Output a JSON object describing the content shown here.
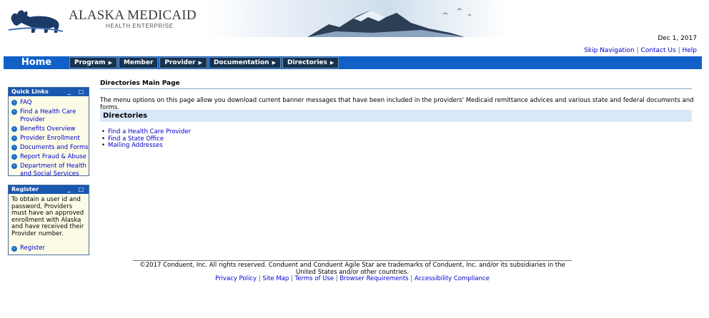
{
  "header": {
    "brand_title": "ALASKA MEDICAID",
    "brand_subtitle": "HEALTH ENTERPRISE",
    "date": "Dec 1, 2017",
    "top_links": [
      "Skip Navigation",
      "Contact Us",
      "Help"
    ]
  },
  "nav": {
    "home": "Home",
    "items": [
      {
        "label": "Program",
        "arrow": true
      },
      {
        "label": "Member",
        "arrow": false
      },
      {
        "label": "Provider",
        "arrow": true
      },
      {
        "label": "Documentation",
        "arrow": true
      },
      {
        "label": "Directories",
        "arrow": true
      }
    ]
  },
  "quick_links": {
    "title": "Quick Links",
    "controls": "_ □",
    "items": [
      "FAQ",
      "Find a Health Care Provider",
      "Benefits Overview",
      "Provider Enrollment",
      "Documents and Forms",
      "Report Fraud & Abuse",
      "Department of Health and Social Services"
    ]
  },
  "register": {
    "title": "Register",
    "controls": "_ □",
    "text": "To obtain a user id and password, Providers must have an approved enrollment with Alaska and have received their Provider number.",
    "link": "Register"
  },
  "main": {
    "title": "Directories Main Page",
    "description": "The menu options on this page allow you download current banner messages that have been included in the providers' Medicaid remittance advices and various state and federal documents and forms.",
    "section": "Directories",
    "links": [
      "Find a Health Care Provider",
      "Find a State Office",
      "Mailing Addresses"
    ]
  },
  "footer": {
    "copyright": "©2017 Conduent, Inc. All rights reserved. Conduent and Conduent Agile Star are trademarks of Conduent, Inc. and/or its subsidiaries in the United States and/or other countries.",
    "links": [
      "Privacy Policy",
      "Site Map",
      "Terms of Use",
      "Browser Requirements",
      "Accessibility Compliance"
    ]
  },
  "colors": {
    "nav_blue": "#1060c8",
    "nav_item": "#17324f",
    "panel_bg": "#fcfce6",
    "section_bg": "#d9e8f8",
    "link": "#0000cc"
  }
}
